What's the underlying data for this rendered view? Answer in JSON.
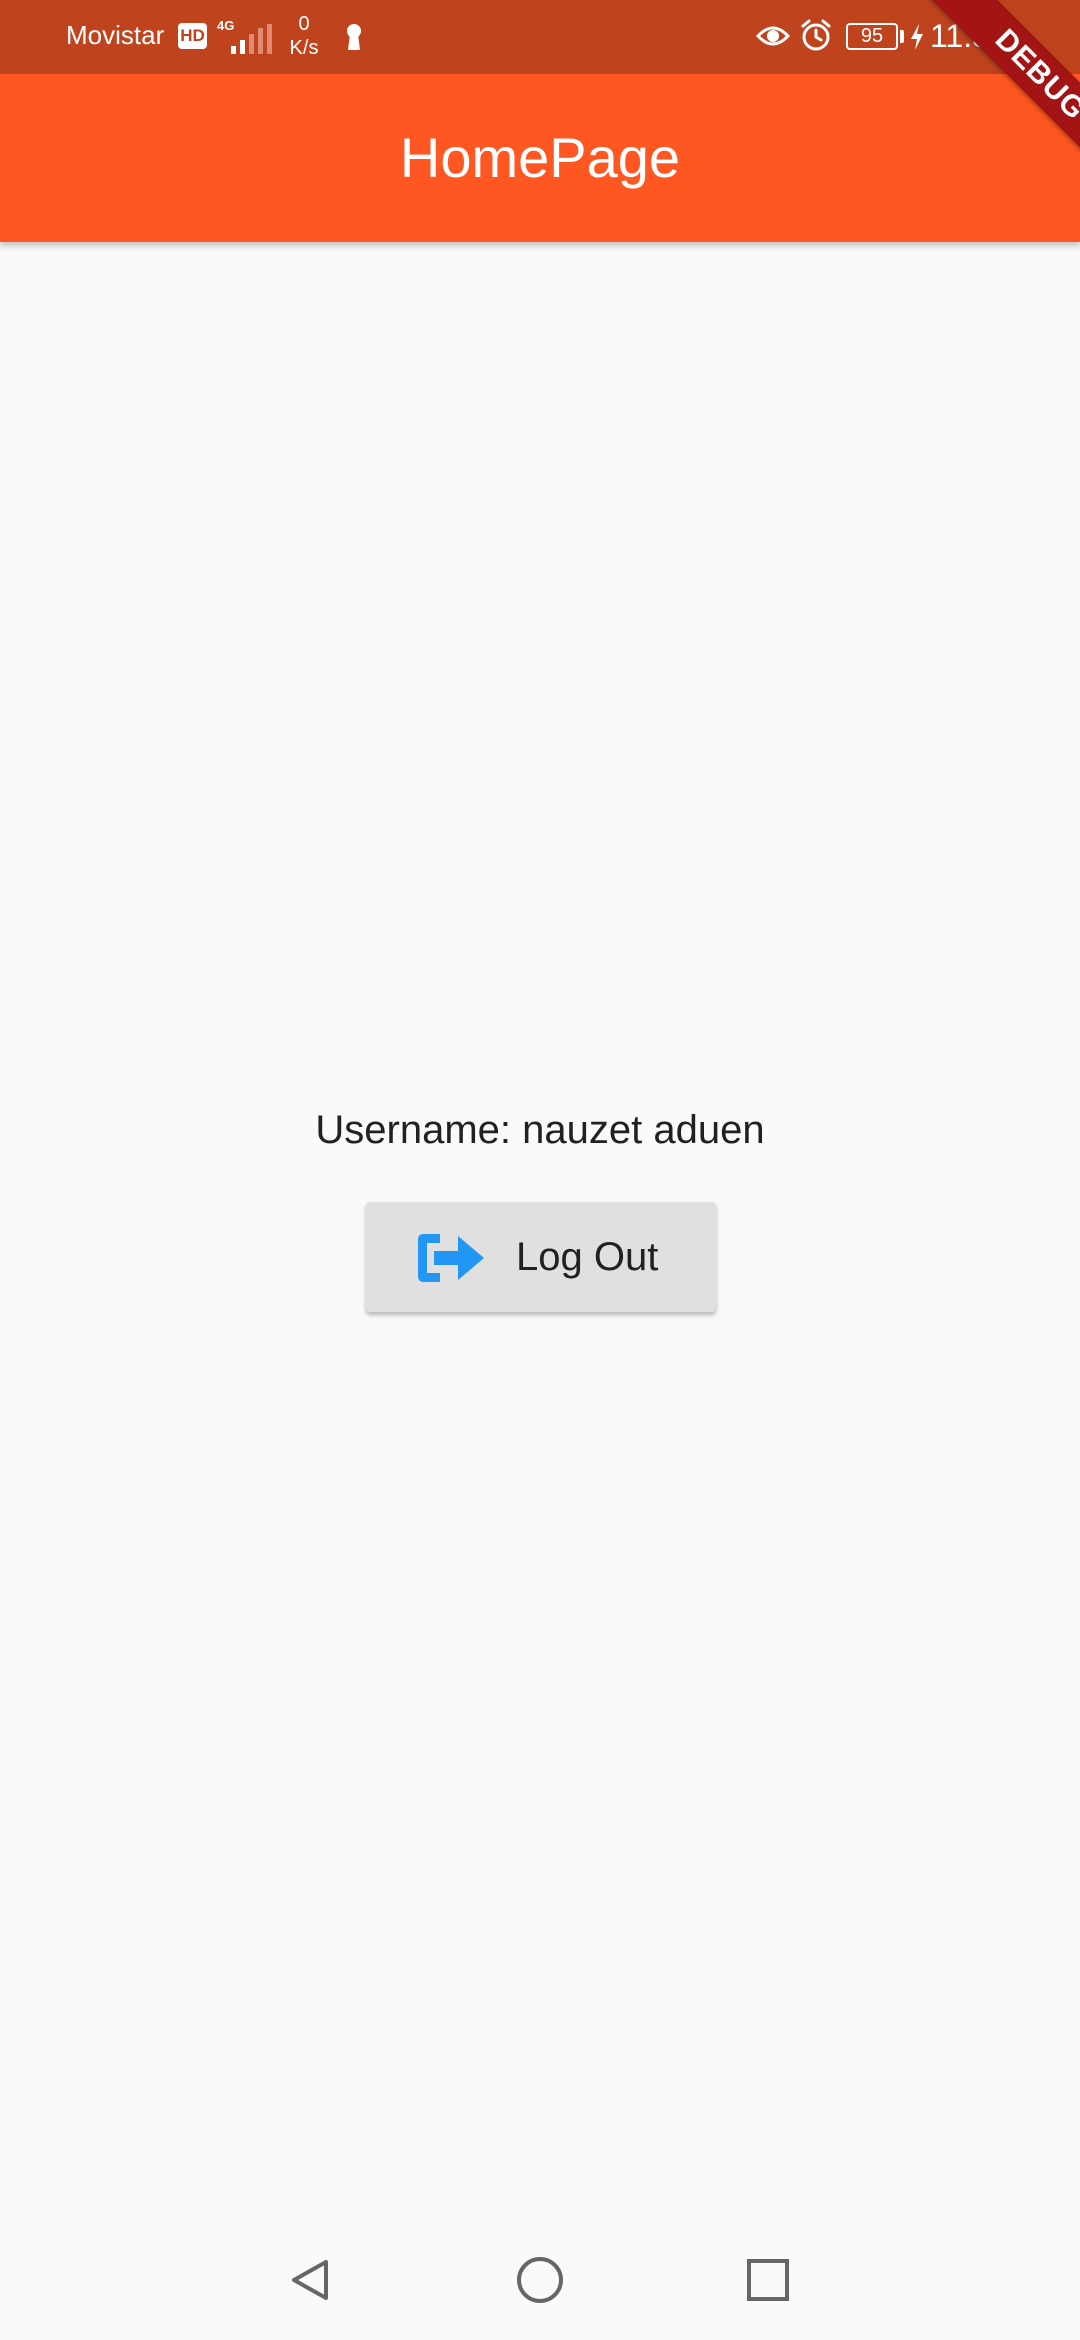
{
  "status_bar": {
    "carrier": "Movistar",
    "hd_badge": "HD",
    "network_type": "4G",
    "speed_value": "0",
    "speed_unit": "K/s",
    "battery_level": "95",
    "time": "11:34",
    "icons": [
      "keyhole-icon",
      "eye-icon",
      "alarm-icon",
      "charging-icon"
    ]
  },
  "debug_banner": {
    "label": "DEBUG"
  },
  "app_bar": {
    "title": "HomePage",
    "color": "#FF5722"
  },
  "main": {
    "username_text": "Username: nauzet aduen",
    "logout_button": {
      "label": "Log Out",
      "icon": "logout-icon",
      "icon_color": "#2196F3"
    }
  },
  "nav_bar": {
    "buttons": [
      "back",
      "home",
      "recents"
    ]
  },
  "colors": {
    "status_bar": "#BF441E",
    "background": "#FAFAFA",
    "button_bg": "#E0E0E0",
    "debug": "#A31515"
  }
}
